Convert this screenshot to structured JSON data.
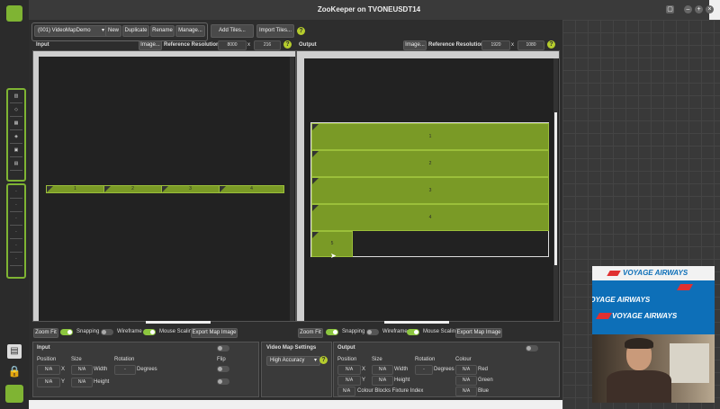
{
  "window": {
    "title": "ZooKeeper on TVONEUSDT14"
  },
  "toolbar": {
    "map_select": "(001) VideoMapDemo",
    "new": "New",
    "duplicate": "Duplicate",
    "rename": "Rename",
    "manage": "Manage...",
    "add_tiles": "Add Tiles...",
    "import_tiles": "Import Tiles...",
    "help": "?"
  },
  "input_panel": {
    "title": "Input",
    "image_btn": "Image...",
    "ref_res_label": "Reference Resolution",
    "ref_w": "8000",
    "ref_h": "216",
    "x": "x",
    "tiles": [
      "1",
      "2",
      "3",
      "4"
    ],
    "zoom_fit": "Zoom Fit",
    "snapping": "Snapping",
    "wireframe": "Wireframe",
    "mouse_scaling": "Mouse Scaling",
    "export": "Export Map Image"
  },
  "output_panel": {
    "title": "Output",
    "image_btn": "Image...",
    "ref_res_label": "Reference Resolution",
    "ref_w": "1920",
    "ref_h": "1080",
    "x": "x",
    "tiles": [
      "1",
      "2",
      "3",
      "4",
      "5"
    ],
    "zoom_fit": "Zoom Fit",
    "snapping": "Snapping",
    "wireframe": "Wireframe",
    "mouse_scaling": "Mouse Scaling",
    "export": "Export Map Image"
  },
  "input_props": {
    "title": "Input",
    "position": "Position",
    "size": "Size",
    "rotation": "Rotation",
    "flip": "Flip",
    "na": "N/A",
    "x": "X",
    "y": "Y",
    "width": "Width",
    "height": "Height",
    "degrees": "Degrees",
    "rot_val": "-"
  },
  "vm_settings": {
    "title": "Video Map Settings",
    "accuracy": "High Accuracy"
  },
  "output_props": {
    "title": "Output",
    "position": "Position",
    "size": "Size",
    "rotation": "Rotation",
    "colour": "Colour",
    "na": "N/A",
    "x": "X",
    "y": "Y",
    "width": "Width",
    "height": "Height",
    "degrees": "Degrees",
    "red": "Red",
    "green": "Green",
    "blue": "Blue",
    "rot_val": "-",
    "colour_blocks": "Colour Blocks Fixture Index"
  },
  "overlay": {
    "brand": "VOYAGE AIRWAYS"
  },
  "colors": {
    "accent": "#7fb433",
    "tile": "#7a9a26",
    "help": "#b5cc2d"
  }
}
